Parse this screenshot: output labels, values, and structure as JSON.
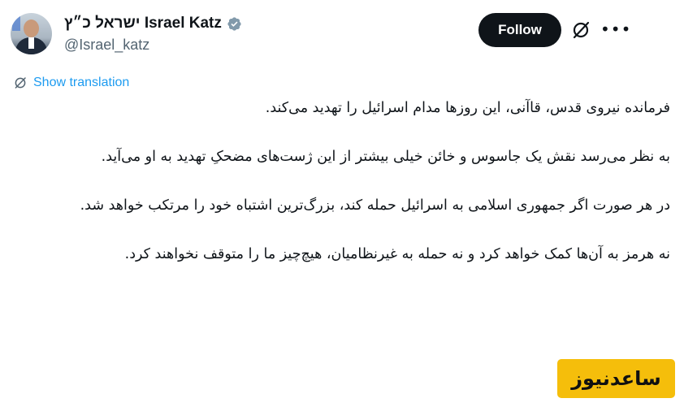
{
  "author": {
    "display_name": "ישראל כ״ץ Israel Katz",
    "handle": "@Israel_katz",
    "verified": true
  },
  "actions": {
    "follow_label": "Follow",
    "more_label": "•••"
  },
  "translation": {
    "label": "Show translation"
  },
  "tweet": {
    "paragraphs": [
      "فرمانده نیروی قدس، قاآنی، این روزها مدام اسرائیل را تهدید می‌کند.",
      "به نظر می‌رسد نقش یک جاسوس و خائن خیلی بیشتر از این ژست‌های مضحکِ تهدید به او می‌آید.",
      "در هر صورت اگر جمهوری اسلامی به اسرائیل حمله کند، بزرگ‌ترین اشتباه خود را مرتکب خواهد شد.",
      "نه هرمز به آن‌ها کمک خواهد کرد و نه حمله به غیرنظامیان، هیچ‌چیز ما را متوقف نخواهند کرد."
    ]
  },
  "watermark": {
    "text": "ساعدنیوز"
  },
  "colors": {
    "accent": "#1d9bf0",
    "follow_bg": "#0f1419",
    "watermark_bg": "#f5be0b",
    "handle_gray": "#536471"
  }
}
